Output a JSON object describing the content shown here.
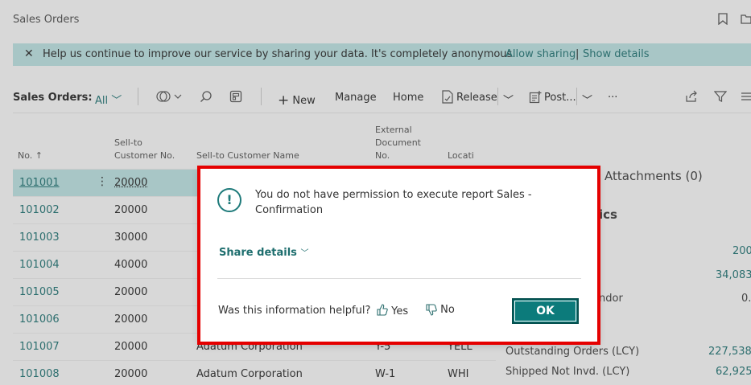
{
  "page": {
    "title": "Sales Orders"
  },
  "banner": {
    "close": "✕",
    "message": "Help us continue to improve our service by sharing your data. It's completely anonymous.",
    "allow_sharing": "Allow sharing",
    "separator": "|",
    "show_details": "Show details"
  },
  "toolbar": {
    "label": "Sales Orders:",
    "filter": "All",
    "new": "New",
    "manage": "Manage",
    "home": "Home",
    "release": "Release",
    "post": "Post...",
    "more": "···"
  },
  "columns": {
    "no": "No. ↑",
    "sell_to_no": [
      "Sell-to",
      "Customer No."
    ],
    "sell_to_name": "Sell-to Customer Name",
    "external_doc": [
      "External",
      "Document",
      "No."
    ],
    "location": "Locati"
  },
  "rows": [
    {
      "no": "101001",
      "cust": "20000",
      "name": "",
      "ext": "",
      "loc": ""
    },
    {
      "no": "101002",
      "cust": "20000",
      "name": "",
      "ext": "",
      "loc": ""
    },
    {
      "no": "101003",
      "cust": "30000",
      "name": "",
      "ext": "",
      "loc": ""
    },
    {
      "no": "101004",
      "cust": "40000",
      "name": "",
      "ext": "",
      "loc": ""
    },
    {
      "no": "101005",
      "cust": "20000",
      "name": "",
      "ext": "",
      "loc": ""
    },
    {
      "no": "101006",
      "cust": "20000",
      "name": "",
      "ext": "",
      "loc": ""
    },
    {
      "no": "101007",
      "cust": "20000",
      "name": "Adatum Corporation",
      "ext": "Y-5",
      "loc": "YELL"
    },
    {
      "no": "101008",
      "cust": "20000",
      "name": "Adatum Corporation",
      "ext": "W-1",
      "loc": "WHI"
    }
  ],
  "factbox": {
    "attachments": "Attachments (0)",
    "heading_tail": "ics",
    "v1": "200",
    "v2": "34,083.",
    "vendor_tail": "ndor",
    "v3": "0.",
    "outstanding_label": "Outstanding Orders (LCY)",
    "outstanding_value": "227,538.",
    "shipped_label": "Shipped Not Invd. (LCY)",
    "shipped_value": "62,925."
  },
  "dialog": {
    "icon": "!",
    "message": "You do not have permission to execute report Sales - Confirmation",
    "share_details": "Share details",
    "helpful_question": "Was this information helpful?",
    "yes": "Yes",
    "no": "No",
    "ok": "OK"
  },
  "colors": {
    "accent": "#0c7b7b",
    "highlight": "#e50000",
    "banner": "#a8c6c6"
  }
}
